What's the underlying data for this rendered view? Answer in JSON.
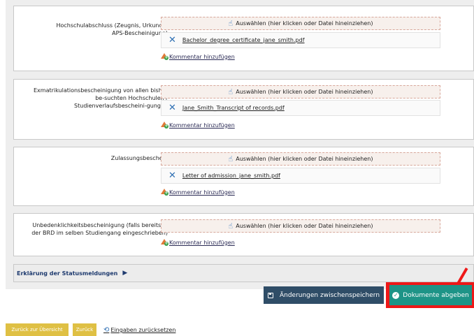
{
  "documents": [
    {
      "label": "Hochschulabschluss (Zeugnis, Urkunde, APS-Bescheinigung)",
      "dropzone_text": "Auswählen (hier klicken oder Datei hineinziehen)",
      "file": "Bachelor_degree_certificate_jane_smith.pdf",
      "comment_link": "Kommentar hinzufügen"
    },
    {
      "label": "Exmatrikulationsbescheinigung von allen bisher be-suchten Hochschulen / Studienverlaufsbescheini-gungen",
      "dropzone_text": "Auswählen (hier klicken oder Datei hineinziehen)",
      "file": "Jane_Smith_Transcript of records.pdf",
      "comment_link": "Kommentar hinzufügen"
    },
    {
      "label": "Zulassungsbescheid",
      "dropzone_text": "Auswählen (hier klicken oder Datei hineinziehen)",
      "file": "Letter of admission_jane_smith.pdf",
      "comment_link": "Kommentar hinzufügen"
    },
    {
      "label": "Unbedenklichkeitsbescheinigung (falls bereits in der BRD im selben Studiengang eingeschrieben)",
      "dropzone_text": "Auswählen (hier klicken oder Datei hineinziehen)",
      "file": null,
      "comment_link": "Kommentar hinzufügen"
    }
  ],
  "status_explanation": "Erklärung der Statusmeldungen",
  "actions": {
    "save": "Änderungen zwischenspeichern",
    "submit": "Dokumente abgeben"
  },
  "footer": {
    "back_overview": "Zurück zur Übersicht",
    "back": "Zurück",
    "reset": "Eingaben zurücksetzen"
  },
  "colors": {
    "submit": "#1e9487",
    "save": "#2f4d67",
    "highlight": "#ee1818",
    "footer_button": "#dfc044"
  }
}
